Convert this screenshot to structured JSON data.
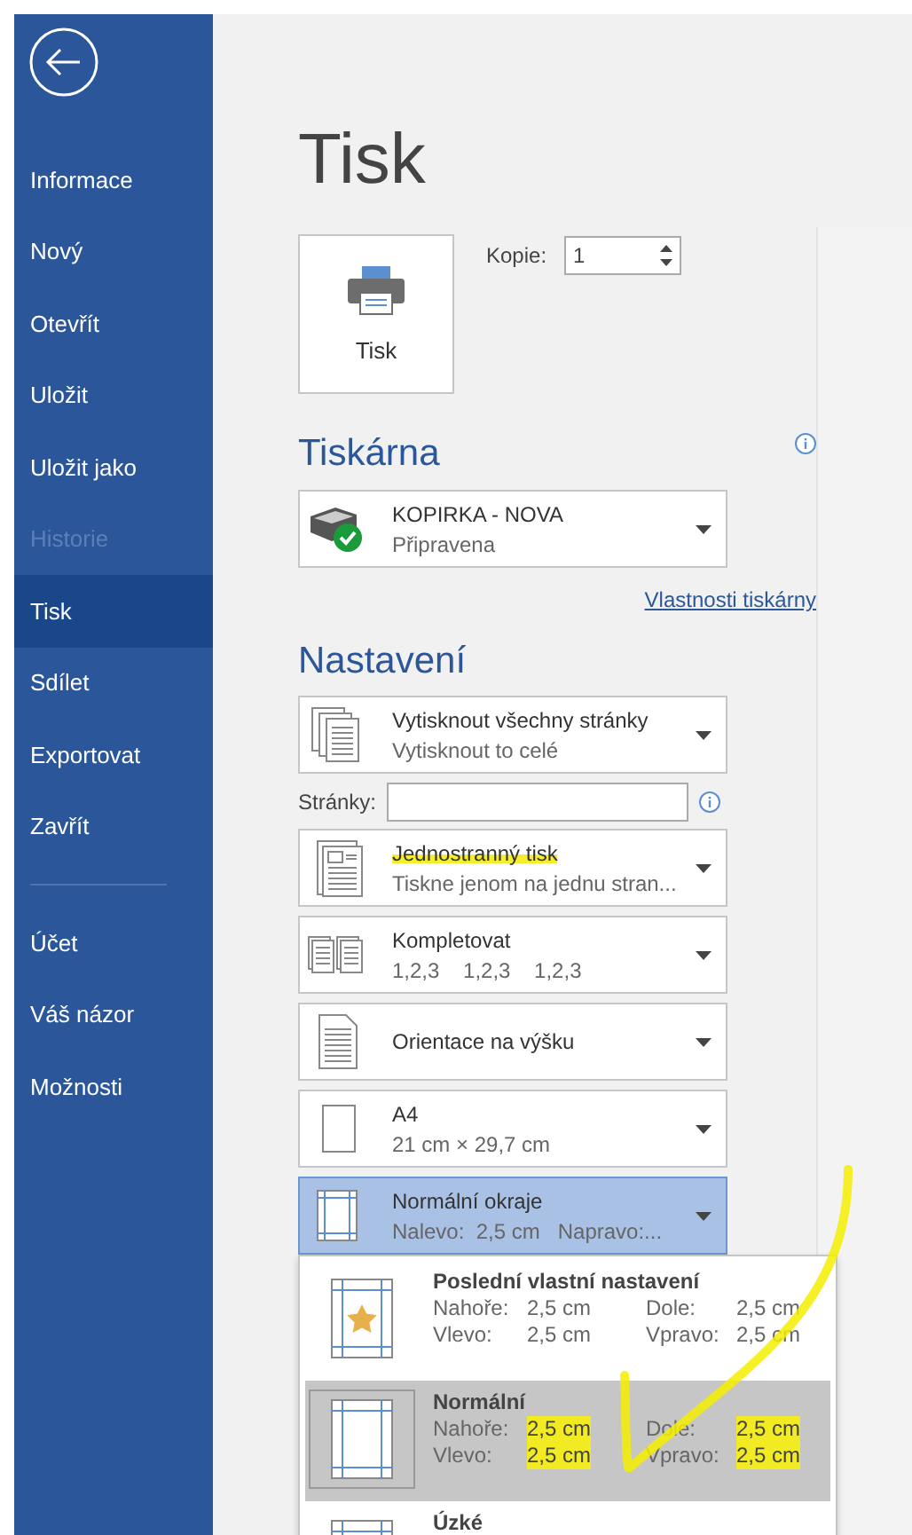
{
  "sidebar": {
    "items": [
      {
        "label": "Informace",
        "selected": false,
        "disabled": false
      },
      {
        "label": "Nový",
        "selected": false,
        "disabled": false
      },
      {
        "label": "Otevřít",
        "selected": false,
        "disabled": false
      },
      {
        "label": "Uložit",
        "selected": false,
        "disabled": false
      },
      {
        "label": "Uložit jako",
        "selected": false,
        "disabled": false
      },
      {
        "label": "Historie",
        "selected": false,
        "disabled": true
      },
      {
        "label": "Tisk",
        "selected": true,
        "disabled": false
      },
      {
        "label": "Sdílet",
        "selected": false,
        "disabled": false
      },
      {
        "label": "Exportovat",
        "selected": false,
        "disabled": false
      },
      {
        "label": "Zavřít",
        "selected": false,
        "disabled": false
      }
    ],
    "bottom_items": [
      {
        "label": "Účet",
        "selected": false,
        "disabled": false
      },
      {
        "label": "Váš názor",
        "selected": false,
        "disabled": false
      },
      {
        "label": "Možnosti",
        "selected": false,
        "disabled": false
      }
    ]
  },
  "title": "Tisk",
  "print_button": {
    "label": "Tisk"
  },
  "copies": {
    "label": "Kopie:",
    "value": "1"
  },
  "printer": {
    "heading": "Tiskárna",
    "name": "KOPIRKA - NOVA",
    "status": "Připravena",
    "ready": true,
    "link": "Vlastnosti tiskárny"
  },
  "settings": {
    "heading": "Nastavení",
    "controls": [
      {
        "kind": "pages",
        "title": "Vytisknout všechny stránky",
        "subtitle": "Vytisknout to celé",
        "expanded": false,
        "highlighted": false
      },
      {
        "kind": "field",
        "label": "Stránky:"
      },
      {
        "kind": "sides",
        "title": "Jednostranný tisk",
        "subtitle": "Tiskne jenom na jednu stran...",
        "expanded": false,
        "highlighted": true
      },
      {
        "kind": "collate",
        "title": "Kompletovat",
        "subtitle": "1,2,3    1,2,3    1,2,3",
        "expanded": false,
        "highlighted": false
      },
      {
        "kind": "orientation",
        "title": "Orientace na výšku",
        "expanded": false,
        "highlighted": false
      },
      {
        "kind": "paper",
        "title": "A4",
        "subtitle": "21 cm × 29,7 cm",
        "expanded": false,
        "highlighted": false
      },
      {
        "kind": "margins",
        "title": "Normální okraje",
        "subtitle": "Nalevo:  2,5 cm   Napravo:...",
        "expanded": true,
        "highlighted": false
      }
    ]
  },
  "margin_menu": {
    "items": [
      {
        "kind": "custom",
        "title": "Poslední vlastní nastavení",
        "selected": false,
        "values": [
          {
            "label": "Nahoře:",
            "value": "2,5 cm",
            "highlighted": false
          },
          {
            "label": "Dole:",
            "value": "2,5 cm",
            "highlighted": false
          },
          {
            "label": "Vlevo:",
            "value": "2,5 cm",
            "highlighted": false
          },
          {
            "label": "Vpravo:",
            "value": "2,5 cm",
            "highlighted": false
          }
        ]
      },
      {
        "kind": "preset",
        "title": "Normální",
        "selected": true,
        "values": [
          {
            "label": "Nahoře:",
            "value": "2,5 cm",
            "highlighted": true
          },
          {
            "label": "Dole:",
            "value": "2,5 cm",
            "highlighted": true
          },
          {
            "label": "Vlevo:",
            "value": "2,5 cm",
            "highlighted": true
          },
          {
            "label": "Vpravo:",
            "value": "2,5 cm",
            "highlighted": true
          }
        ]
      },
      {
        "kind": "preset",
        "title": "Úzké",
        "selected": false
      }
    ]
  }
}
